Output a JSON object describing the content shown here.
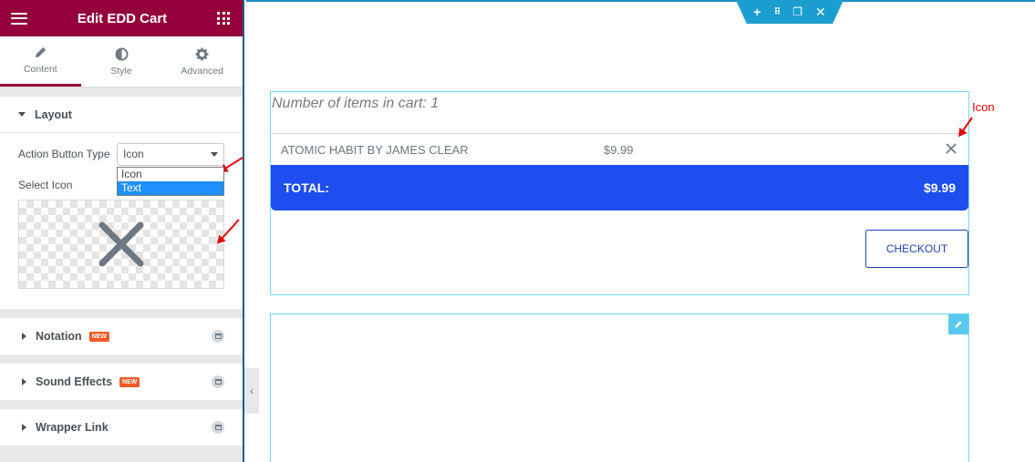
{
  "sidebar": {
    "title": "Edit EDD Cart",
    "tabs": [
      {
        "label": "Content",
        "icon": "pencil-icon"
      },
      {
        "label": "Style",
        "icon": "contrast-icon"
      },
      {
        "label": "Advanced",
        "icon": "gear-icon"
      }
    ],
    "layout": {
      "heading": "Layout",
      "action_button_type_label": "Action Button Type",
      "action_button_type_value": "Icon",
      "dropdown_options": [
        "Icon",
        "Text"
      ],
      "dropdown_highlighted": "Text",
      "select_icon_label": "Select Icon"
    },
    "sections": [
      {
        "label": "Notation",
        "badge": "NEW"
      },
      {
        "label": "Sound Effects",
        "badge": "NEW"
      },
      {
        "label": "Wrapper Link",
        "badge": ""
      }
    ]
  },
  "preview": {
    "items_count_text": "Number of items in cart: 1",
    "cart_item": {
      "name": "ATOMIC HABIT BY JAMES CLEAR",
      "price": "$9.99"
    },
    "total_label": "TOTAL:",
    "total_value": "$9.99",
    "checkout_label": "CHECKOUT",
    "annotation_label": "Icon"
  },
  "colors": {
    "brand": "#93003a",
    "total_bar": "#1e4ef0",
    "handle": "#1c9dcf",
    "annotation": "#e8000a"
  }
}
